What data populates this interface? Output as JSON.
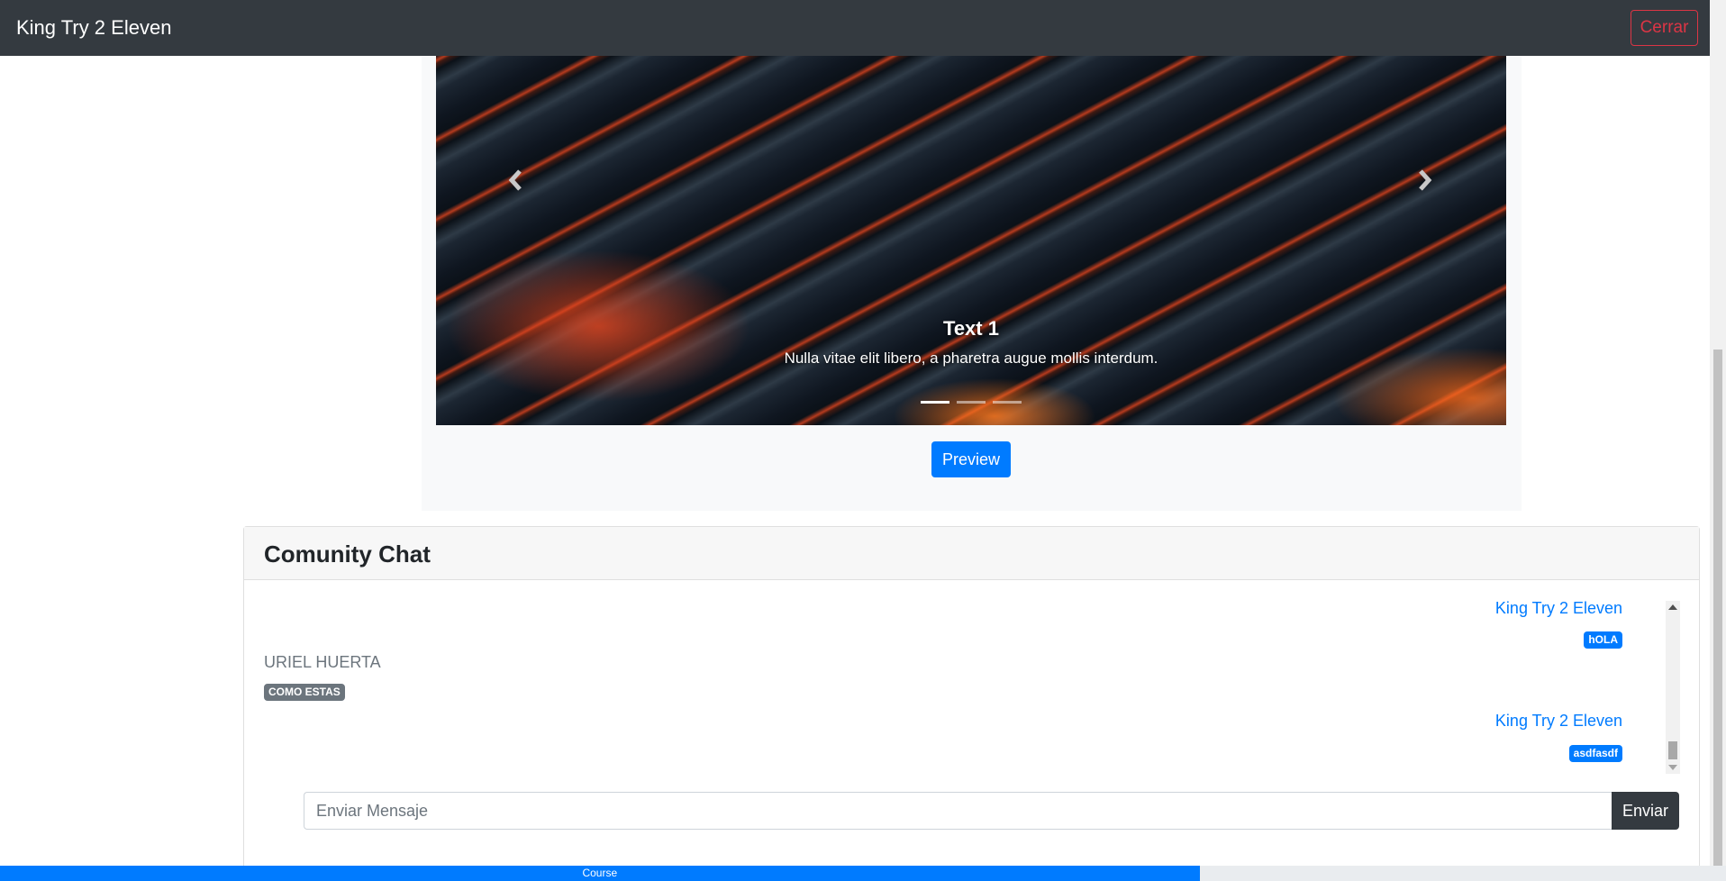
{
  "navbar": {
    "brand": "King Try 2 Eleven",
    "close_label": "Cerrar"
  },
  "carousel": {
    "slide_title": "Text 1",
    "slide_text": "Nulla vitae elit libero, a pharetra augue mollis interdum.",
    "slide_count": 3,
    "active_slide": 1,
    "prev_icon": "chevron-left-icon",
    "next_icon": "chevron-right-icon"
  },
  "preview_label": "Preview",
  "chat": {
    "title": "Comunity Chat",
    "messages": [
      {
        "sender": "King Try 2 Eleven",
        "text": "hOLA",
        "mine": true
      },
      {
        "sender": "URIEL HUERTA",
        "text": "COMO ESTAS",
        "mine": false
      },
      {
        "sender": "King Try 2 Eleven",
        "text": "asdfasdf",
        "mine": true
      }
    ],
    "input_placeholder": "Enviar Mensaje",
    "send_label": "Enviar"
  },
  "progress": {
    "label": "Course",
    "value_percent": 69.5
  },
  "colors": {
    "navbar": "#343a40",
    "primary": "#007bff",
    "danger": "#dc3545",
    "secondary": "#6c757d"
  }
}
